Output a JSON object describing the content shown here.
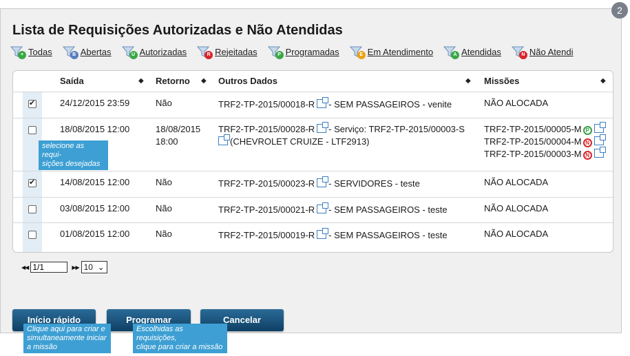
{
  "step_badge": "2",
  "title": "Lista de Requisições Autorizadas e Não Atendidas",
  "filters": [
    {
      "label": "Todas",
      "letter": "+",
      "color": "#3aa847",
      "icon": "filter-funnel-icon"
    },
    {
      "label": "Abertas",
      "letter": "B",
      "color": "#5a7dbf",
      "icon": "filter-funnel-icon"
    },
    {
      "label": "Autorizadas",
      "letter": "U",
      "color": "#3aa847",
      "icon": "filter-funnel-icon"
    },
    {
      "label": "Rejeitadas",
      "letter": "R",
      "color": "#d9252a",
      "icon": "filter-funnel-icon"
    },
    {
      "label": "Programadas",
      "letter": "P",
      "color": "#3aa847",
      "icon": "filter-funnel-icon"
    },
    {
      "label": "Em Atendimento",
      "letter": "E",
      "color": "#e8a317",
      "icon": "filter-funnel-icon"
    },
    {
      "label": "Atendidas",
      "letter": "A",
      "color": "#3aa847",
      "icon": "filter-funnel-icon"
    },
    {
      "label": "Não Atendi",
      "letter": "N",
      "color": "#d9252a",
      "icon": "filter-funnel-icon"
    }
  ],
  "table": {
    "headers": {
      "saida": "Saída",
      "retorno": "Retorno",
      "outros": "Outros Dados",
      "missoes": "Missões"
    },
    "sort_glyph": "◆",
    "rows": [
      {
        "checked": true,
        "saida": "24/12/2015 23:59",
        "retorno": "Não",
        "req": "TRF2-TP-2015/00018-R",
        "desc": "- SEM PASSAGEIROS - venite",
        "desc2": "",
        "missoes_text": "NÃO ALOCADA",
        "missoes": []
      },
      {
        "checked": false,
        "saida": "18/08/2015 12:00",
        "retorno": "18/08/2015\n18:00",
        "req": "TRF2-TP-2015/00028-R",
        "desc": "- Serviço: TRF2-TP-2015/00003-S",
        "desc2": "(CHEVROLET CRUIZE - LTF2913)",
        "missoes_text": "",
        "missoes": [
          {
            "code": "TRF2-TP-2015/00005-M",
            "status": "P"
          },
          {
            "code": "TRF2-TP-2015/00004-M",
            "status": "N"
          },
          {
            "code": "TRF2-TP-2015/00003-M",
            "status": "N"
          }
        ]
      },
      {
        "checked": true,
        "saida": "14/08/2015 12:00",
        "retorno": "Não",
        "req": "TRF2-TP-2015/00023-R",
        "desc": "- SERVIDORES - teste",
        "desc2": "",
        "missoes_text": "NÃO ALOCADA",
        "missoes": []
      },
      {
        "checked": false,
        "saida": "03/08/2015 12:00",
        "retorno": "Não",
        "req": "TRF2-TP-2015/00021-R",
        "desc": "- SEM PASSAGEIROS - teste",
        "desc2": "",
        "missoes_text": "NÃO ALOCADA",
        "missoes": []
      },
      {
        "checked": false,
        "saida": "01/08/2015 12:00",
        "retorno": "Não",
        "req": "TRF2-TP-2015/00019-R",
        "desc": "- SEM PASSAGEIROS - teste",
        "desc2": "",
        "missoes_text": "NÃO ALOCADA",
        "missoes": []
      }
    ]
  },
  "tips": {
    "select": "selecione as requi-\nsições desejadas",
    "inicio": "Clique aqui para criar e\nsimultaneamente iniciar\na missão",
    "programar": "Escolhidas as requisições,\nclique para criar a missão"
  },
  "pager": {
    "first": "◀◀",
    "prev": "◀◀",
    "next": "▶▶",
    "last": "▶▶",
    "page": "1/1",
    "page_size": "10"
  },
  "buttons": {
    "inicio": "Início rápido",
    "programar": "Programar",
    "cancelar": "Cancelar"
  },
  "colors": {
    "button": "#0f3f63",
    "tooltip": "#3d9fd3",
    "link_icon": "#3a7ec2"
  }
}
